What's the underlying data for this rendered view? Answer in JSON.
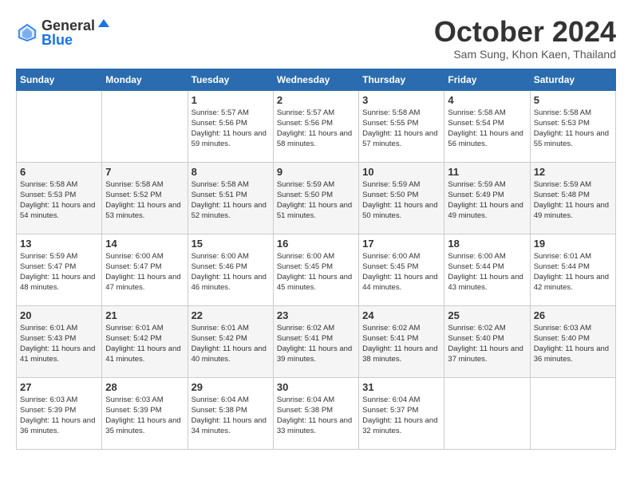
{
  "logo": {
    "general": "General",
    "blue": "Blue"
  },
  "header": {
    "month": "October 2024",
    "location": "Sam Sung, Khon Kaen, Thailand"
  },
  "weekdays": [
    "Sunday",
    "Monday",
    "Tuesday",
    "Wednesday",
    "Thursday",
    "Friday",
    "Saturday"
  ],
  "weeks": [
    [
      {
        "day": "",
        "info": ""
      },
      {
        "day": "",
        "info": ""
      },
      {
        "day": "1",
        "info": "Sunrise: 5:57 AM\nSunset: 5:56 PM\nDaylight: 11 hours and 59 minutes."
      },
      {
        "day": "2",
        "info": "Sunrise: 5:57 AM\nSunset: 5:56 PM\nDaylight: 11 hours and 58 minutes."
      },
      {
        "day": "3",
        "info": "Sunrise: 5:58 AM\nSunset: 5:55 PM\nDaylight: 11 hours and 57 minutes."
      },
      {
        "day": "4",
        "info": "Sunrise: 5:58 AM\nSunset: 5:54 PM\nDaylight: 11 hours and 56 minutes."
      },
      {
        "day": "5",
        "info": "Sunrise: 5:58 AM\nSunset: 5:53 PM\nDaylight: 11 hours and 55 minutes."
      }
    ],
    [
      {
        "day": "6",
        "info": "Sunrise: 5:58 AM\nSunset: 5:53 PM\nDaylight: 11 hours and 54 minutes."
      },
      {
        "day": "7",
        "info": "Sunrise: 5:58 AM\nSunset: 5:52 PM\nDaylight: 11 hours and 53 minutes."
      },
      {
        "day": "8",
        "info": "Sunrise: 5:58 AM\nSunset: 5:51 PM\nDaylight: 11 hours and 52 minutes."
      },
      {
        "day": "9",
        "info": "Sunrise: 5:59 AM\nSunset: 5:50 PM\nDaylight: 11 hours and 51 minutes."
      },
      {
        "day": "10",
        "info": "Sunrise: 5:59 AM\nSunset: 5:50 PM\nDaylight: 11 hours and 50 minutes."
      },
      {
        "day": "11",
        "info": "Sunrise: 5:59 AM\nSunset: 5:49 PM\nDaylight: 11 hours and 49 minutes."
      },
      {
        "day": "12",
        "info": "Sunrise: 5:59 AM\nSunset: 5:48 PM\nDaylight: 11 hours and 49 minutes."
      }
    ],
    [
      {
        "day": "13",
        "info": "Sunrise: 5:59 AM\nSunset: 5:47 PM\nDaylight: 11 hours and 48 minutes."
      },
      {
        "day": "14",
        "info": "Sunrise: 6:00 AM\nSunset: 5:47 PM\nDaylight: 11 hours and 47 minutes."
      },
      {
        "day": "15",
        "info": "Sunrise: 6:00 AM\nSunset: 5:46 PM\nDaylight: 11 hours and 46 minutes."
      },
      {
        "day": "16",
        "info": "Sunrise: 6:00 AM\nSunset: 5:45 PM\nDaylight: 11 hours and 45 minutes."
      },
      {
        "day": "17",
        "info": "Sunrise: 6:00 AM\nSunset: 5:45 PM\nDaylight: 11 hours and 44 minutes."
      },
      {
        "day": "18",
        "info": "Sunrise: 6:00 AM\nSunset: 5:44 PM\nDaylight: 11 hours and 43 minutes."
      },
      {
        "day": "19",
        "info": "Sunrise: 6:01 AM\nSunset: 5:44 PM\nDaylight: 11 hours and 42 minutes."
      }
    ],
    [
      {
        "day": "20",
        "info": "Sunrise: 6:01 AM\nSunset: 5:43 PM\nDaylight: 11 hours and 41 minutes."
      },
      {
        "day": "21",
        "info": "Sunrise: 6:01 AM\nSunset: 5:42 PM\nDaylight: 11 hours and 41 minutes."
      },
      {
        "day": "22",
        "info": "Sunrise: 6:01 AM\nSunset: 5:42 PM\nDaylight: 11 hours and 40 minutes."
      },
      {
        "day": "23",
        "info": "Sunrise: 6:02 AM\nSunset: 5:41 PM\nDaylight: 11 hours and 39 minutes."
      },
      {
        "day": "24",
        "info": "Sunrise: 6:02 AM\nSunset: 5:41 PM\nDaylight: 11 hours and 38 minutes."
      },
      {
        "day": "25",
        "info": "Sunrise: 6:02 AM\nSunset: 5:40 PM\nDaylight: 11 hours and 37 minutes."
      },
      {
        "day": "26",
        "info": "Sunrise: 6:03 AM\nSunset: 5:40 PM\nDaylight: 11 hours and 36 minutes."
      }
    ],
    [
      {
        "day": "27",
        "info": "Sunrise: 6:03 AM\nSunset: 5:39 PM\nDaylight: 11 hours and 36 minutes."
      },
      {
        "day": "28",
        "info": "Sunrise: 6:03 AM\nSunset: 5:39 PM\nDaylight: 11 hours and 35 minutes."
      },
      {
        "day": "29",
        "info": "Sunrise: 6:04 AM\nSunset: 5:38 PM\nDaylight: 11 hours and 34 minutes."
      },
      {
        "day": "30",
        "info": "Sunrise: 6:04 AM\nSunset: 5:38 PM\nDaylight: 11 hours and 33 minutes."
      },
      {
        "day": "31",
        "info": "Sunrise: 6:04 AM\nSunset: 5:37 PM\nDaylight: 11 hours and 32 minutes."
      },
      {
        "day": "",
        "info": ""
      },
      {
        "day": "",
        "info": ""
      }
    ]
  ]
}
